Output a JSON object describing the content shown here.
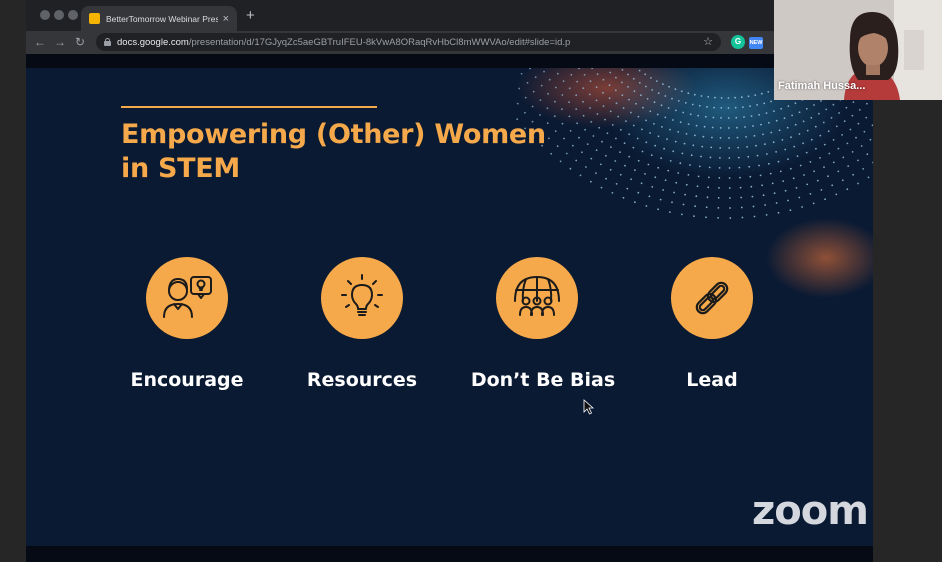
{
  "browser": {
    "tab_title": "BetterTomorrow Webinar Prese",
    "tab_close": "×",
    "new_tab": "+",
    "back": "←",
    "forward": "→",
    "reload": "↻",
    "url_host": "docs.google.com",
    "url_path": "/presentation/d/17GJyqZc5aeGBTruIFEU-8kVwA8ORaqRvHbCl8mWWVAo/edit#slide=id.p",
    "bookmark": "☆",
    "ext_grammarly": "G",
    "ext_new_badge": "NEW"
  },
  "slide": {
    "title_line1": "Empowering (Other) Women",
    "title_line2": "in STEM",
    "pillars": [
      {
        "label": "Encourage",
        "icon": "person-lightbulb-icon"
      },
      {
        "label": "Resources",
        "icon": "lightbulb-icon"
      },
      {
        "label": "Don’t Be Bias",
        "icon": "globe-people-icon"
      },
      {
        "label": "Lead",
        "icon": "chain-link-icon"
      }
    ],
    "accent_color": "#f6a94a",
    "background_color": "#0a1a33"
  },
  "zoom": {
    "logo_text": "zoom",
    "participant_name": "Fatimah Hussa..."
  }
}
